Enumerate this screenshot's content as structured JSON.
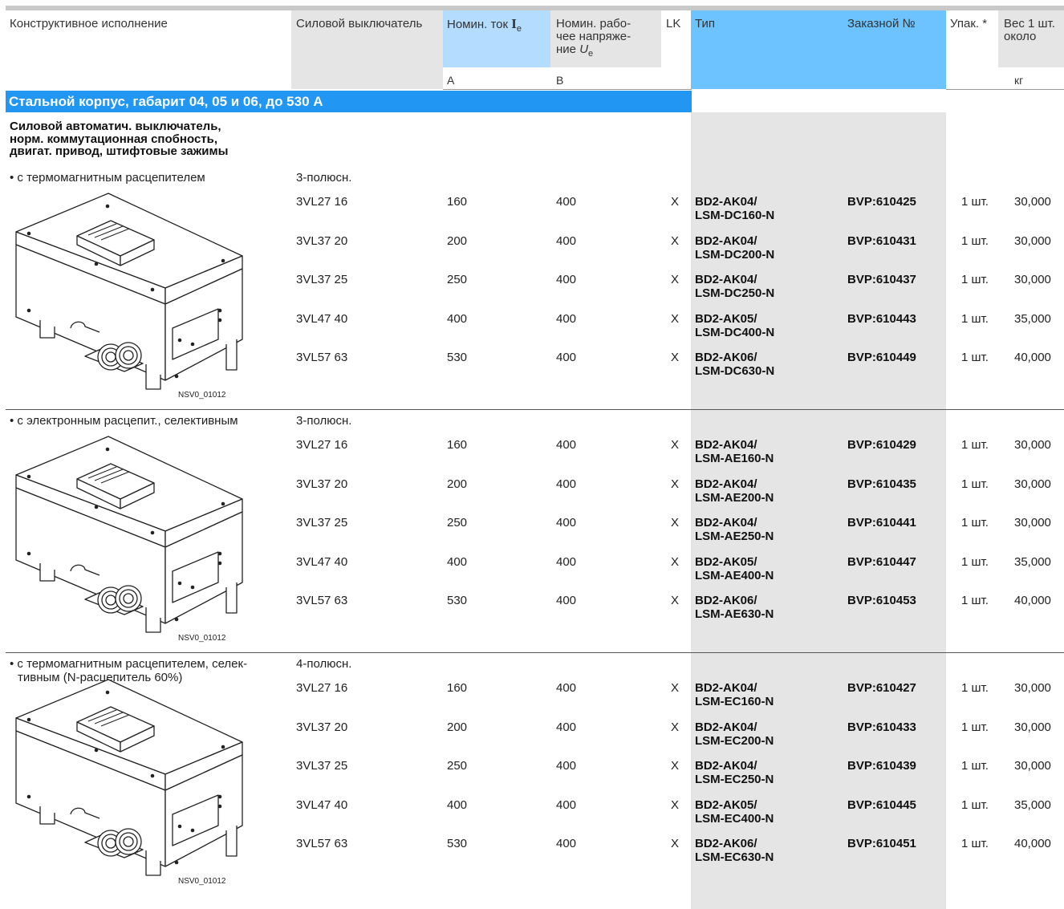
{
  "header": {
    "col_design": "Конструктивное исполнение",
    "col_breaker": "Силовой выключатель",
    "col_current": "Номин. ток",
    "col_current_sym": "I",
    "col_current_sub": "e",
    "col_voltage_l1": "Номин. рабо-",
    "col_voltage_l2": "чее напряже-",
    "col_voltage_l3": "ние",
    "col_voltage_sym": "U",
    "col_voltage_sub": "e",
    "col_lk": "LK",
    "col_type": "Тип",
    "col_order": "Заказной №",
    "col_pack": "Упак. *",
    "col_weight_l1": "Вес 1 шт.",
    "col_weight_l2": "около",
    "unit_current": "А",
    "unit_voltage": "В",
    "unit_weight": "кг"
  },
  "section_title": "Стальной корпус, габарит 04, 05 и 06, до 530 А",
  "group_title": [
    "Силовой автоматич. выключатель,",
    "норм. коммутационная спобность,",
    "двигат. привод, штифтовые зажимы"
  ],
  "drawing_code": "NSV0_01012",
  "groups": [
    {
      "bullet": [
        "• с термомагнитным расцепителем"
      ],
      "poles": "3-полюсн.",
      "rows": [
        {
          "breaker": "3VL27 16",
          "current": "160",
          "voltage": "400",
          "lk": "X",
          "type1": "BD2-AK04/",
          "type2": "LSM-DC160-N",
          "order": "BVP:610425",
          "pack": "1 шт.",
          "weight": "30,000"
        },
        {
          "breaker": "3VL37 20",
          "current": "200",
          "voltage": "400",
          "lk": "X",
          "type1": "BD2-AK04/",
          "type2": "LSM-DC200-N",
          "order": "BVP:610431",
          "pack": "1 шт.",
          "weight": "30,000"
        },
        {
          "breaker": "3VL37 25",
          "current": "250",
          "voltage": "400",
          "lk": "X",
          "type1": "BD2-AK04/",
          "type2": "LSM-DC250-N",
          "order": "BVP:610437",
          "pack": "1 шт.",
          "weight": "30,000"
        },
        {
          "breaker": "3VL47 40",
          "current": "400",
          "voltage": "400",
          "lk": "X",
          "type1": "BD2-AK05/",
          "type2": "LSM-DC400-N",
          "order": "BVP:610443",
          "pack": "1 шт.",
          "weight": "35,000"
        },
        {
          "breaker": "3VL57 63",
          "current": "530",
          "voltage": "400",
          "lk": "X",
          "type1": "BD2-AK06/",
          "type2": "LSM-DC630-N",
          "order": "BVP:610449",
          "pack": "1 шт.",
          "weight": "40,000"
        }
      ]
    },
    {
      "bullet": [
        "• с электронным расцепит., селективным"
      ],
      "poles": "3-полюсн.",
      "rows": [
        {
          "breaker": "3VL27 16",
          "current": "160",
          "voltage": "400",
          "lk": "X",
          "type1": "BD2-AK04/",
          "type2": "LSM-AE160-N",
          "order": "BVP:610429",
          "pack": "1 шт.",
          "weight": "30,000"
        },
        {
          "breaker": "3VL37 20",
          "current": "200",
          "voltage": "400",
          "lk": "X",
          "type1": "BD2-AK04/",
          "type2": "LSM-AE200-N",
          "order": "BVP:610435",
          "pack": "1 шт.",
          "weight": "30,000"
        },
        {
          "breaker": "3VL37 25",
          "current": "250",
          "voltage": "400",
          "lk": "X",
          "type1": "BD2-AK04/",
          "type2": "LSM-AE250-N",
          "order": "BVP:610441",
          "pack": "1 шт.",
          "weight": "30,000"
        },
        {
          "breaker": "3VL47 40",
          "current": "400",
          "voltage": "400",
          "lk": "X",
          "type1": "BD2-AK05/",
          "type2": "LSM-AE400-N",
          "order": "BVP:610447",
          "pack": "1 шт.",
          "weight": "35,000"
        },
        {
          "breaker": "3VL57 63",
          "current": "530",
          "voltage": "400",
          "lk": "X",
          "type1": "BD2-AK06/",
          "type2": "LSM-AE630-N",
          "order": "BVP:610453",
          "pack": "1 шт.",
          "weight": "40,000"
        }
      ]
    },
    {
      "bullet": [
        "• с термомагнитным расцепителем, селек-",
        "тивным (N-расцепитель 60%)"
      ],
      "poles": "4-полюсн.",
      "rows": [
        {
          "breaker": "3VL27 16",
          "current": "160",
          "voltage": "400",
          "lk": "X",
          "type1": "BD2-AK04/",
          "type2": "LSM-EC160-N",
          "order": "BVP:610427",
          "pack": "1 шт.",
          "weight": "30,000"
        },
        {
          "breaker": "3VL37 20",
          "current": "200",
          "voltage": "400",
          "lk": "X",
          "type1": "BD2-AK04/",
          "type2": "LSM-EC200-N",
          "order": "BVP:610433",
          "pack": "1 шт.",
          "weight": "30,000"
        },
        {
          "breaker": "3VL37 25",
          "current": "250",
          "voltage": "400",
          "lk": "X",
          "type1": "BD2-AK04/",
          "type2": "LSM-EC250-N",
          "order": "BVP:610439",
          "pack": "1 шт.",
          "weight": "30,000"
        },
        {
          "breaker": "3VL47 40",
          "current": "400",
          "voltage": "400",
          "lk": "X",
          "type1": "BD2-AK05/",
          "type2": "LSM-EC400-N",
          "order": "BVP:610445",
          "pack": "1 шт.",
          "weight": "35,000"
        },
        {
          "breaker": "3VL57 63",
          "current": "530",
          "voltage": "400",
          "lk": "X",
          "type1": "BD2-AK06/",
          "type2": "LSM-EC630-N",
          "order": "BVP:610451",
          "pack": "1 шт.",
          "weight": "40,000"
        }
      ]
    }
  ]
}
